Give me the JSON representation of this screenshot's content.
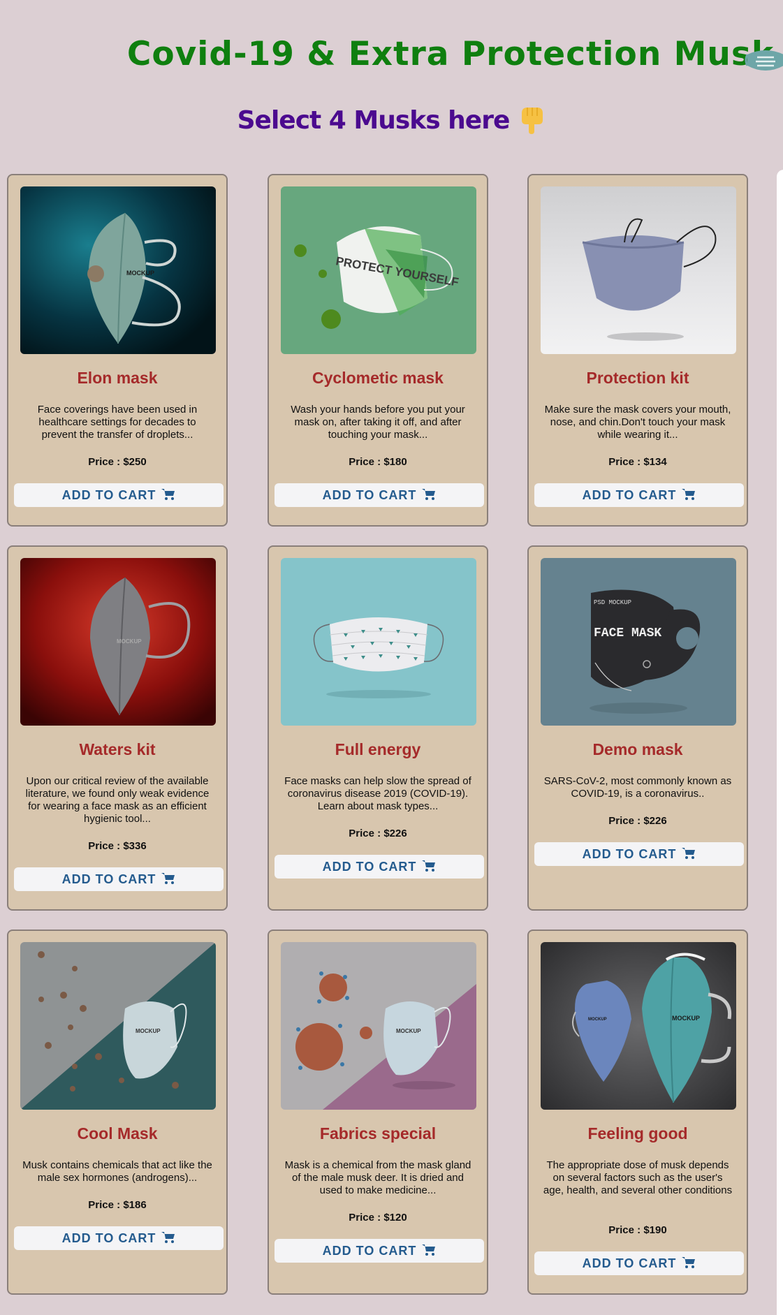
{
  "header": {
    "title": "Covid-19 & Extra Protection Musk",
    "subtitle": "Select 4 Musks here"
  },
  "colors": {
    "page_background": "#dccfd3",
    "title": "#0f7f0f",
    "subtitle": "#4b0a8f",
    "card_background": "#d8c6ae",
    "product_name": "#a52a2a",
    "cart_button_text": "#245b8e"
  },
  "icons": {
    "header": "face-mask-icon",
    "subtitle": "pointing-down-hand-icon",
    "cart": "shopping-cart-icon"
  },
  "products": [
    {
      "name": "Elon mask",
      "description": "Face coverings have been used in healthcare settings for decades to prevent the transfer of droplets...",
      "price": "Price : $250",
      "button": "ADD TO CART"
    },
    {
      "name": "Cyclometic mask",
      "description": "Wash your hands before you put your mask on, after taking it off, and after touching your mask...",
      "price": "Price : $180",
      "button": "ADD TO CART"
    },
    {
      "name": "Protection kit",
      "description": "Make sure the mask covers your mouth, nose, and chin.Don't touch your mask while wearing it...",
      "price": "Price : $134",
      "button": "ADD TO CART"
    },
    {
      "name": "Waters kit",
      "description": "Upon our critical review of the available literature, we found only weak evidence for wearing a face mask as an efficient hygienic tool...",
      "price": "Price : $336",
      "button": "ADD TO CART"
    },
    {
      "name": "Full energy",
      "description": "Face masks can help slow the spread of coronavirus disease 2019 (COVID-19). Learn about mask types...",
      "price": "Price : $226",
      "button": "ADD TO CART"
    },
    {
      "name": "Demo mask",
      "description": "SARS-CoV-2, most commonly known as COVID-19, is a coronavirus..",
      "price": "Price : $226",
      "button": "ADD TO CART"
    },
    {
      "name": "Cool Mask",
      "description": "Musk contains chemicals that act like the male sex hormones (androgens)...",
      "price": "Price : $186",
      "button": "ADD TO CART"
    },
    {
      "name": "Fabrics special",
      "description": "Mask is a chemical from the mask gland of the male musk deer. It is dried and used to make medicine...",
      "price": "Price : $120",
      "button": "ADD TO CART"
    },
    {
      "name": "Feeling good",
      "description": "The appropriate dose of musk depends on several factors such as the user's age, health, and several other conditions",
      "price": "Price : $190",
      "button": "ADD TO CART"
    }
  ],
  "photo_labels": {
    "mockup": "MOCKUP",
    "protect_yourself": "PROTECT YOURSELF",
    "psd_mockup": "PSD MOCKUP",
    "face_mask": "FACE MASK"
  }
}
